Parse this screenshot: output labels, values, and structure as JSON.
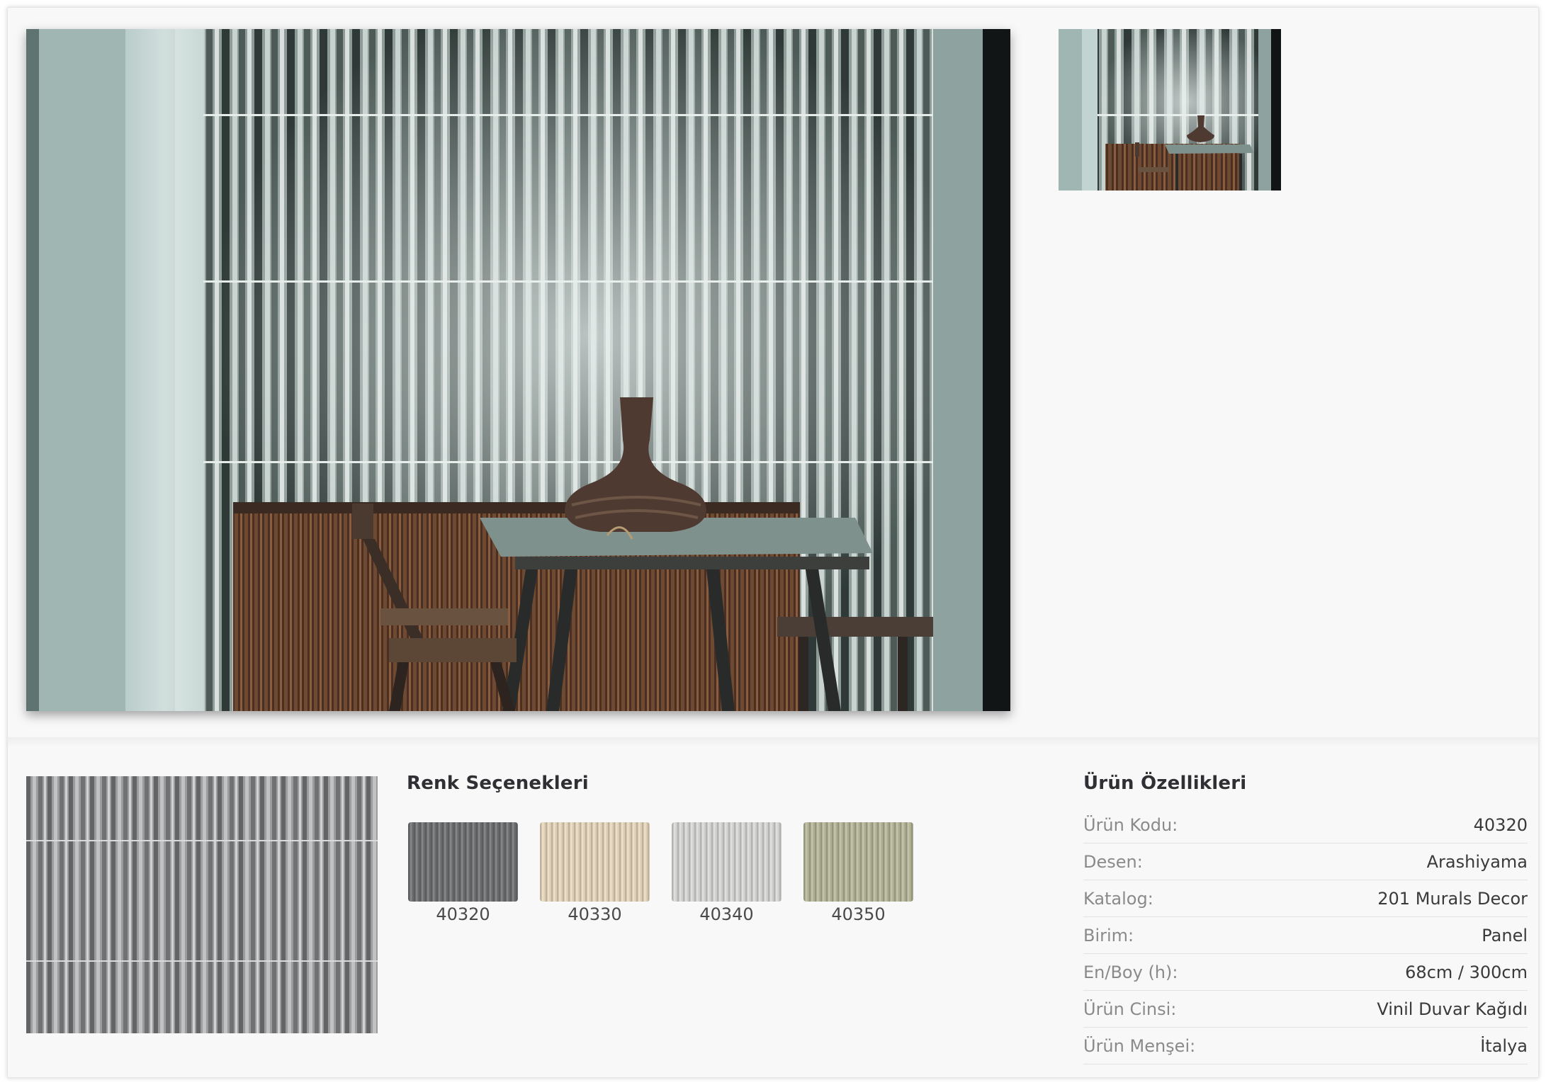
{
  "gallery": {
    "main_image": "bamboo-forest-room-photo",
    "thumbnail": "bamboo-forest-room-thumbnail"
  },
  "pattern_image": "bamboo-pattern-sample",
  "colors": {
    "title": "Renk Seçenekleri",
    "options": [
      {
        "code": "40320",
        "color": "#6e7072"
      },
      {
        "code": "40330",
        "color": "#e8d8bd"
      },
      {
        "code": "40340",
        "color": "#d9d9d7"
      },
      {
        "code": "40350",
        "color": "#b7b79a"
      }
    ]
  },
  "properties": {
    "title": "Ürün Özellikleri",
    "rows": [
      {
        "label": "Ürün Kodu:",
        "value": "40320"
      },
      {
        "label": "Desen:",
        "value": "Arashiyama"
      },
      {
        "label": "Katalog:",
        "value": "201 Murals Decor"
      },
      {
        "label": "Birim:",
        "value": "Panel"
      },
      {
        "label": "En/Boy (h):",
        "value": "68cm / 300cm"
      },
      {
        "label": "Ürün Cinsi:",
        "value": "Vinil Duvar Kağıdı"
      },
      {
        "label": "Ürün Menşei:",
        "value": "İtalya"
      }
    ]
  }
}
